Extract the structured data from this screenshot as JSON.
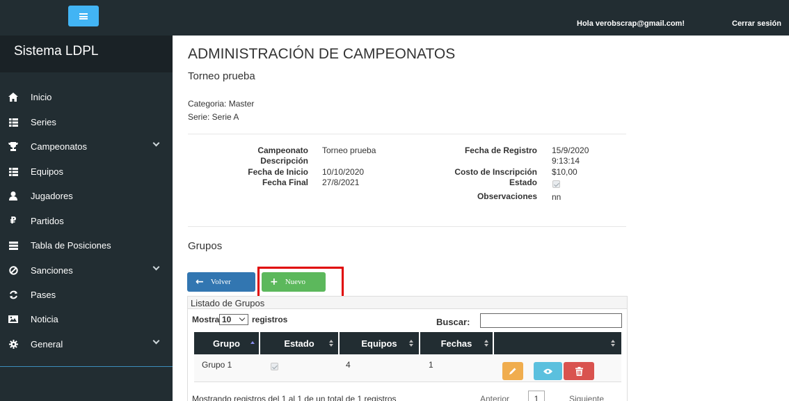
{
  "topbar": {
    "greeting": "Hola verobscrap@gmail.com!",
    "logout_label": "Cerrar sesión",
    "menu_icon": "hamburger-icon"
  },
  "sidebar": {
    "brand": "Sistema LDPL",
    "items": [
      {
        "label": "Inicio",
        "icon": "home-icon",
        "has_submenu": false
      },
      {
        "label": "Series",
        "icon": "grid-icon",
        "has_submenu": false
      },
      {
        "label": "Campeonatos",
        "icon": "trophy-icon",
        "has_submenu": true
      },
      {
        "label": "Equipos",
        "icon": "grid-icon",
        "has_submenu": false
      },
      {
        "label": "Jugadores",
        "icon": "user-icon",
        "has_submenu": false
      },
      {
        "label": "Partidos",
        "icon": "ruble-icon",
        "has_submenu": false
      },
      {
        "label": "Tabla de Posiciones",
        "icon": "list-icon",
        "has_submenu": false
      },
      {
        "label": "Sanciones",
        "icon": "ban-icon",
        "has_submenu": true
      },
      {
        "label": "Pases",
        "icon": "refresh-icon",
        "has_submenu": false
      },
      {
        "label": "Noticia",
        "icon": "image-icon",
        "has_submenu": false
      },
      {
        "label": "General",
        "icon": "gear-icon",
        "has_submenu": true
      }
    ]
  },
  "main": {
    "title": "ADMINISTRACIÓN DE CAMPEONATOS",
    "subtitle": "Torneo prueba",
    "categoria": "Categoria: Master",
    "serie": "Serie: Serie A",
    "details_left": {
      "campeonato_label": "Campeonato",
      "campeonato_value": "Torneo prueba",
      "descripcion_label": "Descripción",
      "descripcion_value": "",
      "fecha_inicio_label": "Fecha de Inicio",
      "fecha_inicio_value": "10/10/2020",
      "fecha_final_label": "Fecha Final",
      "fecha_final_value": "27/8/2021"
    },
    "details_right": {
      "fecha_registro_label": "Fecha de Registro",
      "fecha_registro_date": "15/9/2020",
      "fecha_registro_time": "9:13:14",
      "costo_label": "Costo de Inscripción",
      "costo_value": "$10,00",
      "estado_label": "Estado",
      "estado_checked": true,
      "observaciones_label": "Observaciones",
      "observaciones_value": "nn"
    },
    "section_title": "Grupos",
    "buttons": {
      "volver": "Volver",
      "nuevo": "Nuevo"
    },
    "panel": {
      "heading": "Listado de Grupos",
      "length_prefix": "Mostrar",
      "length_value": "10",
      "length_suffix": "registros",
      "search_label": "Buscar:",
      "search_value": ""
    },
    "table": {
      "headers": [
        "Grupo",
        "Estado",
        "Equipos",
        "Fechas",
        ""
      ],
      "rows": [
        {
          "grupo": "Grupo 1",
          "estado_checked": true,
          "equipos": "4",
          "fechas": "1"
        }
      ]
    },
    "footer": {
      "info": "Mostrando registros del 1 al 1 de un total de 1 registros",
      "prev": "Anterior",
      "page": "1",
      "next": "Siguiente"
    }
  },
  "colors": {
    "sidebar_bg": "#222d32",
    "primary": "#3276b1",
    "success": "#5cb85c",
    "warning": "#f0ad4e",
    "info": "#5bc0de",
    "danger": "#d9534f",
    "highlight": "#e00000"
  }
}
